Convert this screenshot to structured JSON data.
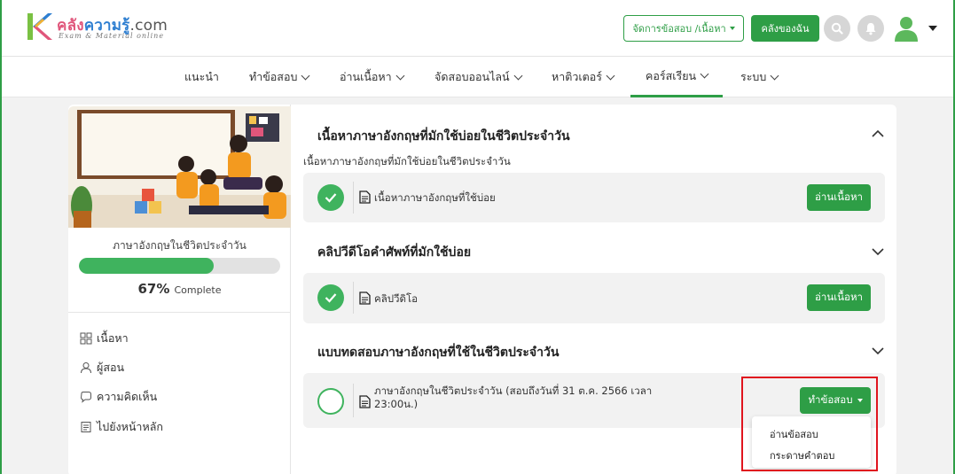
{
  "colors": {
    "brand_green": "#2e9e46",
    "progress_green": "#3fb35e",
    "highlight_red": "#e0141e"
  },
  "header": {
    "logo_text_part1": "คลัง",
    "logo_text_part2": "ความรู้",
    "logo_text_part3": ".com",
    "logo_tagline": "Exam & Material online",
    "manage_button": "จัดการข้อสอบ /เนื้อหา",
    "my_library_button": "คลังของฉัน",
    "icons": [
      "search-icon",
      "bell-icon",
      "user-avatar-icon",
      "caret-down-icon"
    ]
  },
  "nav": {
    "items": [
      {
        "label": "แนะนำ",
        "has_dropdown": false
      },
      {
        "label": "ทำข้อสอบ",
        "has_dropdown": true
      },
      {
        "label": "อ่านเนื้อหา",
        "has_dropdown": true
      },
      {
        "label": "จัดสอบออนไลน์",
        "has_dropdown": true
      },
      {
        "label": "หาติวเตอร์",
        "has_dropdown": true
      },
      {
        "label": "คอร์สเรียน",
        "has_dropdown": true,
        "active": true
      },
      {
        "label": "ระบบ",
        "has_dropdown": true
      }
    ]
  },
  "course": {
    "title": "ภาษาอังกฤษในชีวิตประจำวัน",
    "progress_percent": 67,
    "progress_label": "67%",
    "progress_suffix": "Complete",
    "menu": [
      {
        "label": "เนื้อหา",
        "icon": "grid-icon"
      },
      {
        "label": "ผู้สอน",
        "icon": "person-icon"
      },
      {
        "label": "ความคิดเห็น",
        "icon": "comment-icon"
      },
      {
        "label": "ไปยังหน้าหลัก",
        "icon": "document-icon"
      }
    ]
  },
  "sections": [
    {
      "title": "เนื้อหาภาษาอังกฤษที่มักใช้บ่อยในชีวิตประจำวัน",
      "subtitle": "เนื้อหาภาษาอังกฤษที่มักใช้บ่อยในชีวิตประจำวัน",
      "expanded": true,
      "item_text": "เนื้อหาภาษาอังกฤษที่ใช้บ่อย",
      "item_done": true,
      "button": "อ่านเนื้อหา"
    },
    {
      "title": "คลิปวีดีโอคำศัพท์ที่มักใช้บ่อย",
      "expanded": false,
      "item_text": "คลิปวีดิโอ",
      "item_done": true,
      "button": "อ่านเนื้อหา"
    },
    {
      "title": "แบบทดสอบภาษาอังกฤษที่ใช้ในชีวิตประจำวัน",
      "expanded": false,
      "item_text_line1": "ภาษาอังกฤษในชีวิตประจำวัน (สอบถึงวันที่ 31 ต.ค. 2566 เวลา",
      "item_text_line2": "23:00น.)",
      "item_done": false,
      "button": "ทำข้อสอบ",
      "dropdown": [
        "อ่านข้อสอบ",
        "กระดาษคำตอบ"
      ]
    }
  ]
}
